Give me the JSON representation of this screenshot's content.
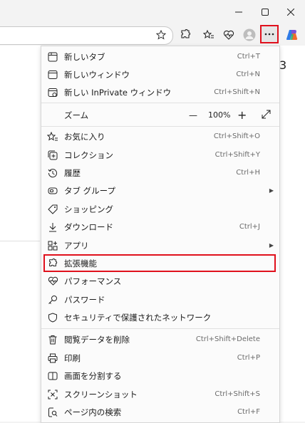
{
  "window": {
    "controls": [
      "minimize",
      "maximize",
      "close"
    ]
  },
  "toolbar": {
    "icons": [
      "favorite-star",
      "extensions",
      "favorites",
      "performance",
      "profile",
      "settings-more",
      "copilot"
    ]
  },
  "menu": {
    "items": [
      {
        "label": "新しいタブ",
        "shortcut": "Ctrl+T"
      },
      {
        "label": "新しいウィンドウ",
        "shortcut": "Ctrl+N"
      },
      {
        "label": "新しい InPrivate ウィンドウ",
        "shortcut": "Ctrl+Shift+N"
      },
      {
        "label": "お気に入り",
        "shortcut": "Ctrl+Shift+O"
      },
      {
        "label": "コレクション",
        "shortcut": "Ctrl+Shift+Y"
      },
      {
        "label": "履歴",
        "shortcut": "Ctrl+H"
      },
      {
        "label": "タブ グループ",
        "shortcut": ""
      },
      {
        "label": "ショッピング",
        "shortcut": ""
      },
      {
        "label": "ダウンロード",
        "shortcut": "Ctrl+J"
      },
      {
        "label": "アプリ",
        "shortcut": ""
      },
      {
        "label": "拡張機能",
        "shortcut": ""
      },
      {
        "label": "パフォーマンス",
        "shortcut": ""
      },
      {
        "label": "パスワード",
        "shortcut": ""
      },
      {
        "label": "セキュリティで保護されたネットワーク",
        "shortcut": ""
      },
      {
        "label": "閲覧データを削除",
        "shortcut": "Ctrl+Shift+Delete"
      },
      {
        "label": "印刷",
        "shortcut": "Ctrl+P"
      },
      {
        "label": "画面を分割する",
        "shortcut": ""
      },
      {
        "label": "スクリーンショット",
        "shortcut": "Ctrl+Shift+S"
      },
      {
        "label": "ページ内の検索",
        "shortcut": "Ctrl+F"
      }
    ],
    "zoom": {
      "label": "ズーム",
      "value": "100%",
      "minus": "—",
      "plus": "+"
    }
  },
  "background": {
    "digit": "3"
  },
  "colors": {
    "highlight": "#e0101c",
    "menu_bg": "#fbfbfb"
  }
}
